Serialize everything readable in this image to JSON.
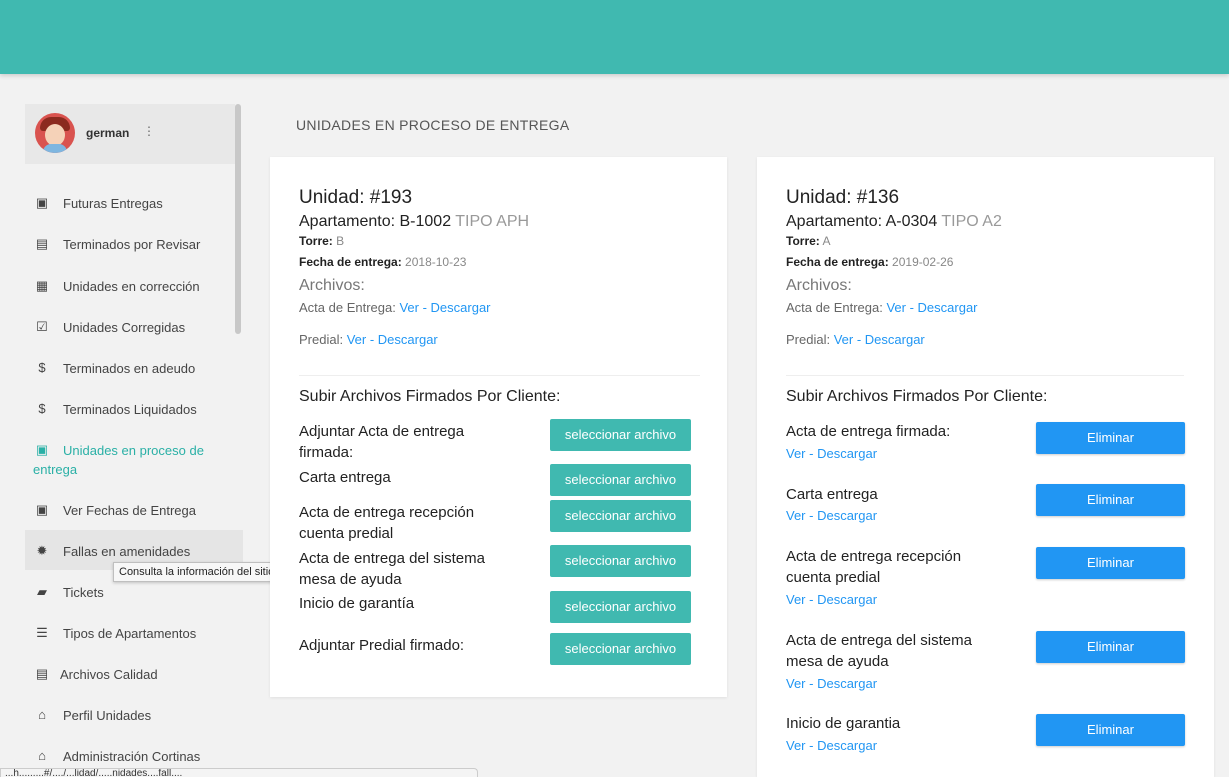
{
  "user": {
    "name": "german",
    "menu_icon": "⋮"
  },
  "sidebar": {
    "items": [
      {
        "icon": "calendar-icon",
        "glyph": "▣",
        "label": "Futuras Entregas"
      },
      {
        "icon": "clipboard-icon",
        "glyph": "▤",
        "label": "Terminados por Revisar"
      },
      {
        "icon": "clipboard-alert-icon",
        "glyph": "▦",
        "label": "Unidades en corrección"
      },
      {
        "icon": "clipboard-check-icon",
        "glyph": "☑",
        "label": "Unidades Corregidas"
      },
      {
        "icon": "money-off-icon",
        "glyph": "$",
        "label": "Terminados en adeudo"
      },
      {
        "icon": "money-icon",
        "glyph": "$",
        "label": "Terminados Liquidados"
      },
      {
        "icon": "assignment-ind-icon",
        "glyph": "▣",
        "label": "Unidades en proceso de",
        "label2": "entrega"
      },
      {
        "icon": "calendar-icon",
        "glyph": "▣",
        "label": "Ver Fechas de Entrega"
      },
      {
        "icon": "bug-icon",
        "glyph": "✹",
        "label": "Fallas en amenidades"
      },
      {
        "icon": "ticket-icon",
        "glyph": "▰",
        "label": "Tickets"
      },
      {
        "icon": "list-icon",
        "glyph": "☰",
        "label": "Tipos de Apartamentos"
      },
      {
        "icon": "library-books-icon",
        "glyph": "▤",
        "label": "Archivos Calidad"
      },
      {
        "icon": "home-icon",
        "glyph": "⌂",
        "label": "Perfil Unidades"
      },
      {
        "icon": "home-icon",
        "glyph": "⌂",
        "label": "Administración Cortinas"
      }
    ]
  },
  "tooltip": "Consulta la información del sitio",
  "statusbar": "...h.........#/..../...lidad/.....nidades....fall....",
  "page": {
    "title": "UNIDADES EN PROCESO DE ENTREGA"
  },
  "cards": [
    {
      "unit": "Unidad: #193",
      "apt_prefix": "Apartamento: B-1002",
      "apt_type": "TIPO APH",
      "torre_label": "Torre:",
      "torre_value": "B",
      "fecha_label": "Fecha de entrega:",
      "fecha_value": "2018-10-23",
      "archivos": "Archivos:",
      "acta_label": "Acta de Entrega:",
      "predial_label": "Predial:",
      "ver": "Ver",
      "sep": " - ",
      "descargar": "Descargar",
      "upload_title": "Subir Archivos Firmados Por Cliente:",
      "button_label": "seleccionar archivo",
      "docs": [
        {
          "l1": "Adjuntar Acta de entrega",
          "l2": "firmada:"
        },
        {
          "l1": "Carta entrega",
          "l2": ""
        },
        {
          "l1": "Acta de entrega recepción",
          "l2": "cuenta predial"
        },
        {
          "l1": "Acta de entrega del sistema",
          "l2": "mesa de ayuda"
        },
        {
          "l1": "Inicio de garantía",
          "l2": ""
        },
        {
          "l1": "Adjuntar Predial firmado:",
          "l2": ""
        }
      ]
    },
    {
      "unit": "Unidad: #136",
      "apt_prefix": "Apartamento: A-0304",
      "apt_type": "TIPO A2",
      "torre_label": "Torre:",
      "torre_value": "A",
      "fecha_label": "Fecha de entrega:",
      "fecha_value": "2019-02-26",
      "archivos": "Archivos:",
      "acta_label": "Acta de Entrega:",
      "predial_label": "Predial:",
      "ver": "Ver",
      "sep": " - ",
      "descargar": "Descargar",
      "upload_title": "Subir Archivos Firmados Por Cliente:",
      "button_label": "Eliminar",
      "docs": [
        {
          "l1": "Acta de entrega firmada:",
          "l2": ""
        },
        {
          "l1": "Carta entrega",
          "l2": ""
        },
        {
          "l1": "Acta de entrega recepción",
          "l2": "cuenta predial"
        },
        {
          "l1": "Acta de entrega del sistema",
          "l2": "mesa de ayuda"
        },
        {
          "l1": "Inicio de garantia",
          "l2": ""
        }
      ]
    }
  ]
}
